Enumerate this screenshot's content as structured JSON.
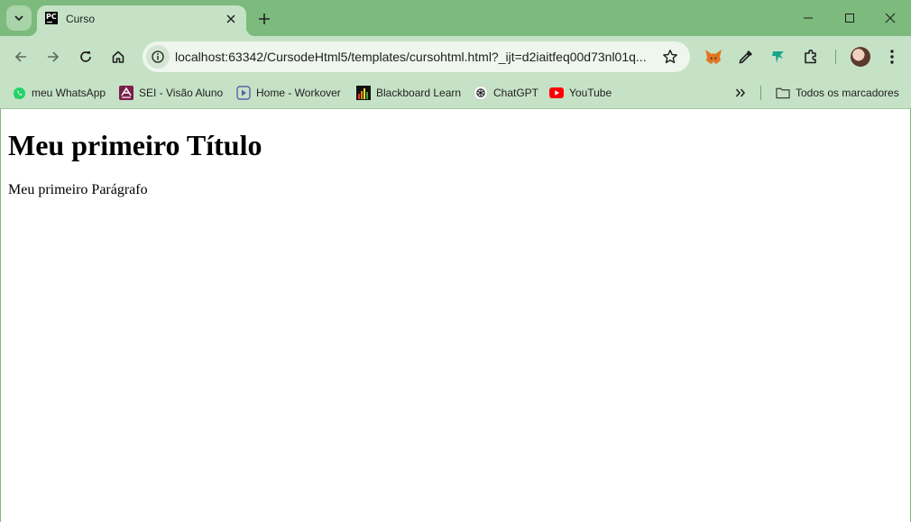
{
  "tab": {
    "title": "Curso",
    "favicon_text": "PC"
  },
  "toolbar": {
    "url": "localhost:63342/CursodeHtml5/templates/cursohtml.html?_ijt=d2iaitfeq00d73nl01q..."
  },
  "bookmarks": {
    "items": [
      {
        "label": "meu WhatsApp",
        "icon": "whatsapp-icon"
      },
      {
        "label": "SEI - Visão Aluno",
        "icon": "sei-icon"
      },
      {
        "label": "Home - Workover",
        "icon": "workover-icon"
      },
      {
        "label": "Blackboard Learn",
        "icon": "blackboard-icon"
      },
      {
        "label": "ChatGPT",
        "icon": "chatgpt-icon"
      },
      {
        "label": "YouTube",
        "icon": "youtube-icon"
      }
    ],
    "all_bookmarks_label": "Todos os marcadores"
  },
  "page": {
    "heading": "Meu primeiro Título",
    "paragraph": "Meu primeiro Parágrafo"
  },
  "colors": {
    "frame": "#7dba7d",
    "toolbar": "#c6e2c6",
    "omnibox": "#eef6ee"
  }
}
